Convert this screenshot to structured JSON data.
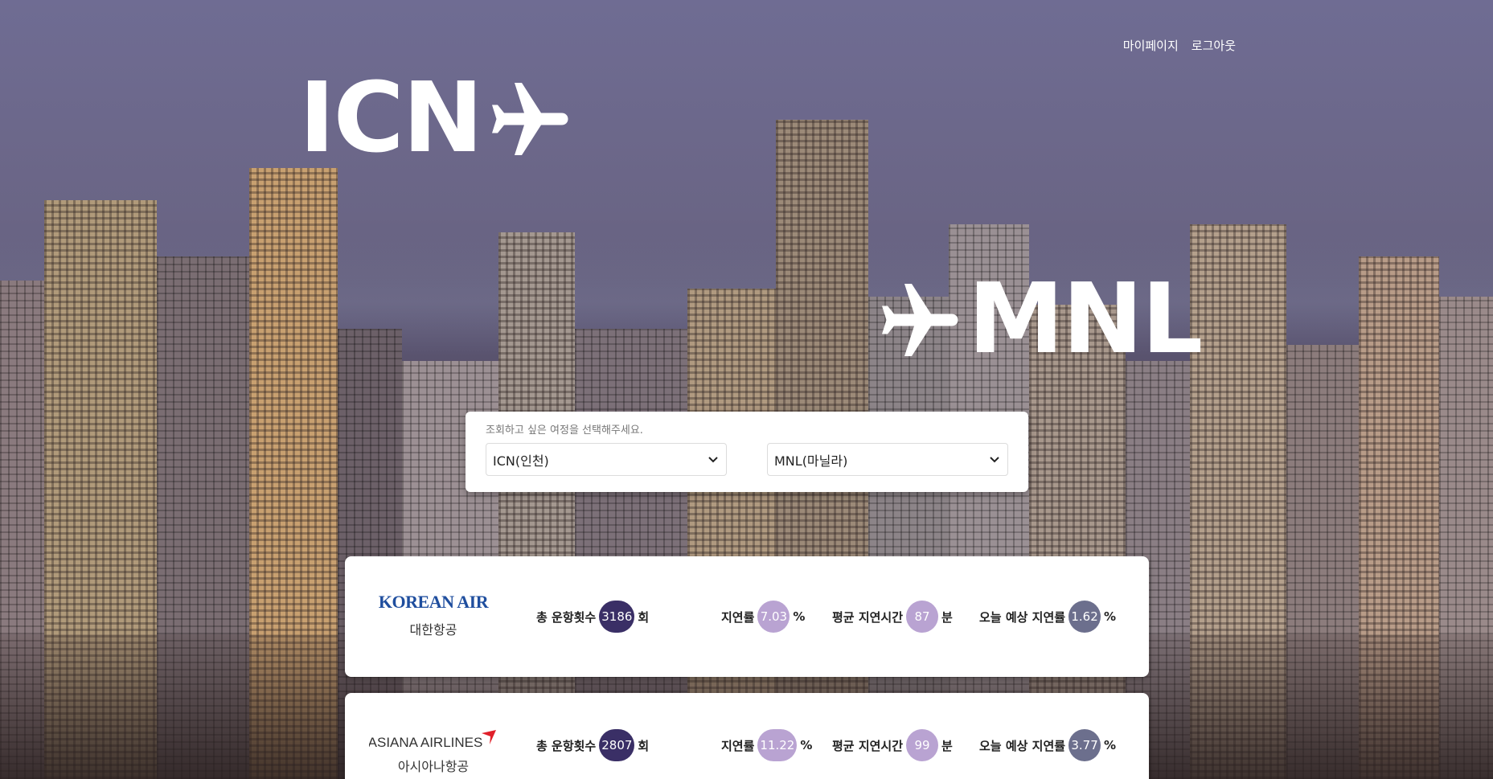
{
  "nav": {
    "mypage": "마이페이지",
    "logout": "로그아웃"
  },
  "route": {
    "origin": "ICN",
    "destination": "MNL"
  },
  "selector": {
    "hint": "조회하고 싶은 여정을 선택해주세요.",
    "origin_value": "ICN(인천)",
    "destination_value": "MNL(마닐라)"
  },
  "labels": {
    "total_flights": "총 운항횟수",
    "total_unit": "회",
    "delay_rate": "지연률",
    "delay_unit": "%",
    "avg_delay": "평균 지연시간",
    "avg_unit": "분",
    "expected_delay": "오늘 예상 지연률",
    "expected_unit": "%"
  },
  "airlines": [
    {
      "logo_text": "KOREAN AIR",
      "name": "대한항공",
      "total_flights": "3186",
      "delay_rate": "7.03",
      "avg_delay": "87",
      "expected_delay": "1.62",
      "brand_color": "#1f4e9e"
    },
    {
      "logo_text": "ASIANA AIRLINES",
      "name": "아시아나항공",
      "total_flights": "2807",
      "delay_rate": "11.22",
      "avg_delay": "99",
      "expected_delay": "3.77",
      "brand_color": "#333333"
    }
  ],
  "colors": {
    "pill_dark": "#3a2f66",
    "pill_light": "#b9a3d2",
    "pill_slate": "#6c6f8d"
  }
}
